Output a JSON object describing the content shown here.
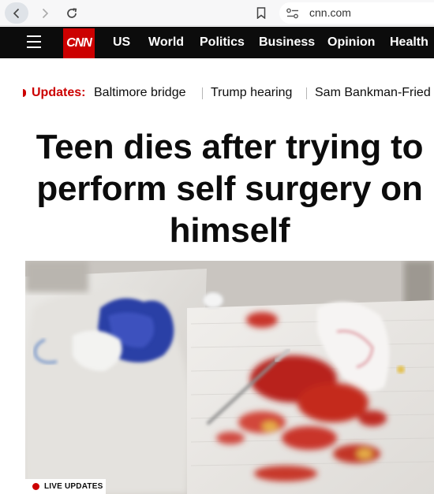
{
  "browser": {
    "url": "cnn.com",
    "icons": [
      "back-arrow-icon",
      "forward-arrow-icon",
      "reload-icon",
      "bookmark-icon",
      "site-info-icon"
    ]
  },
  "header": {
    "logo_text": "CNN",
    "brand_color": "#cc0000",
    "nav": {
      "us": "US",
      "world": "World",
      "politics": "Politics",
      "business": "Business",
      "opinion": "Opinion",
      "health": "Health"
    }
  },
  "ticker": {
    "label": "Updates:",
    "items": [
      "Baltimore bridge",
      "Trump hearing",
      "Sam Bankman-Fried"
    ]
  },
  "article": {
    "headline": "Teen dies after trying to perform self surgery on himself",
    "badge": "LIVE UPDATES"
  }
}
